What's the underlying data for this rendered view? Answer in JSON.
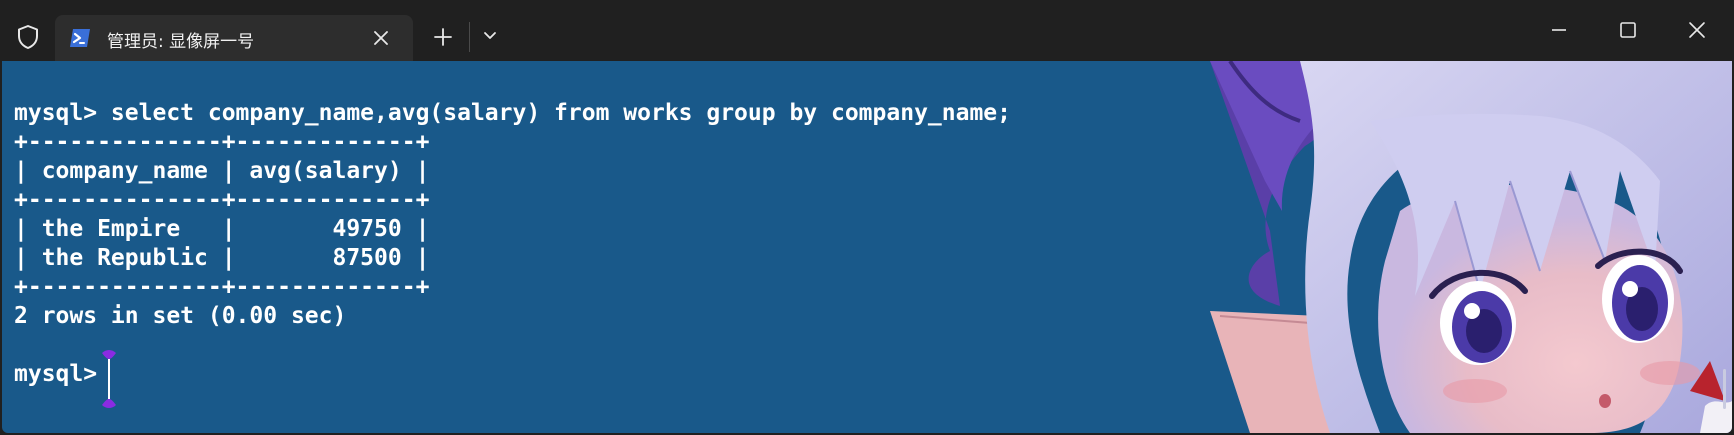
{
  "window": {
    "tab_title": "管理员: 显像屏一号",
    "icons": {
      "shield": "shield-icon",
      "tab": "powershell-icon",
      "tab_close": "close-icon",
      "new_tab": "plus-icon",
      "dropdown": "chevron-down-icon",
      "minimize": "minimize-icon",
      "maximize": "maximize-icon",
      "close": "close-icon"
    }
  },
  "terminal": {
    "background_color": "#19598a",
    "text_color": "#ffffff",
    "lines": [
      "mysql> select company_name,avg(salary) from works group by company_name;",
      "+--------------+-------------+",
      "| company_name | avg(salary) |",
      "+--------------+-------------+",
      "| the Empire   |       49750 |",
      "| the Republic |       87500 |",
      "+--------------+-------------+",
      "2 rows in set (0.00 sec)",
      "",
      "mysql> "
    ]
  }
}
